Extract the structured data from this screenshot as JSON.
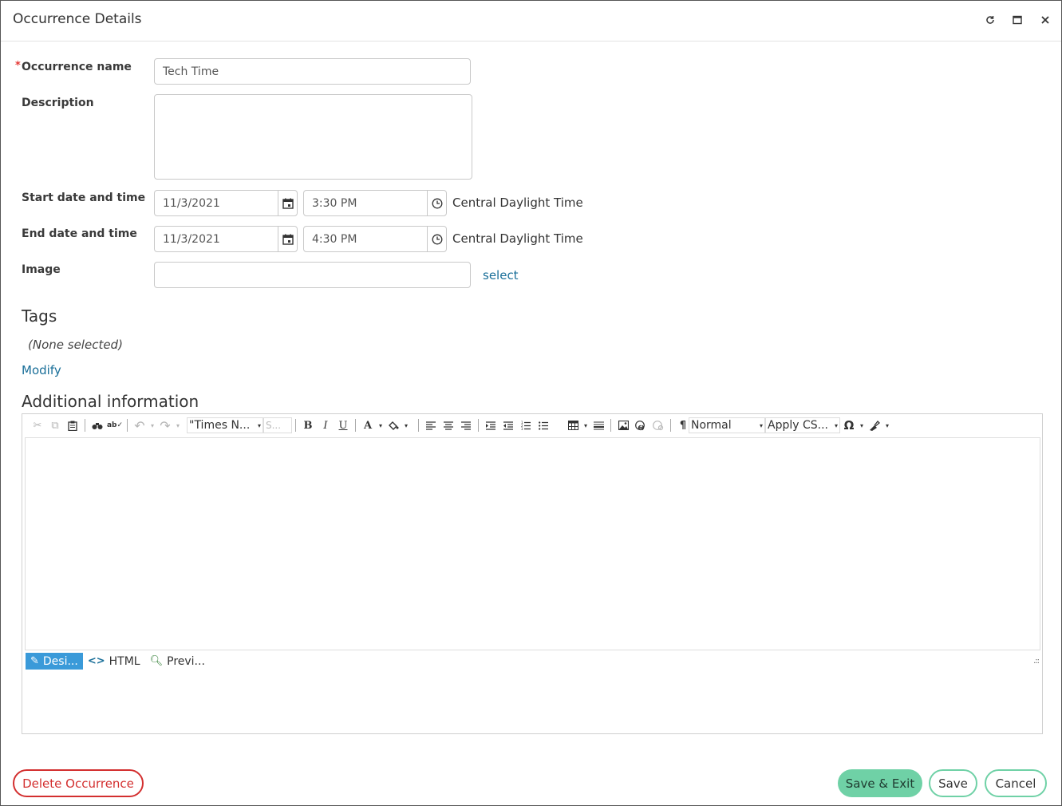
{
  "window": {
    "title": "Occurrence Details",
    "refresh_icon": "refresh-icon",
    "maximize_icon": "maximize-icon",
    "close_icon": "close-icon"
  },
  "form": {
    "occurrence_name": {
      "label": "Occurrence name",
      "required_mark": "*",
      "value": "Tech Time"
    },
    "description": {
      "label": "Description",
      "value": ""
    },
    "start": {
      "label": "Start date and time",
      "date": "11/3/2021",
      "time": "3:30 PM",
      "timezone": "Central Daylight Time"
    },
    "end": {
      "label": "End date and time",
      "date": "11/3/2021",
      "time": "4:30 PM",
      "timezone": "Central Daylight Time"
    },
    "image": {
      "label": "Image",
      "value": "",
      "select_link": "select"
    }
  },
  "tags": {
    "heading": "Tags",
    "none_selected": "(None selected)",
    "modify_link": "Modify"
  },
  "additional": {
    "heading": "Additional information",
    "toolbar": {
      "font_name": "\"Times N...",
      "font_size": "S...",
      "paragraph_style": "Normal",
      "css_class": "Apply CS...",
      "bold": "B",
      "italic": "I",
      "underline": "U",
      "font_color": "A",
      "omega": "Ω",
      "pilcrow": "¶"
    },
    "modes": {
      "design": "Desi...",
      "html": "HTML",
      "preview": "Previ..."
    }
  },
  "footer": {
    "delete_label": "Delete Occurrence",
    "save_exit_label": "Save & Exit",
    "save_label": "Save",
    "cancel_label": "Cancel"
  },
  "colors": {
    "accent_link": "#1a6f99",
    "delete_red": "#d32f2f",
    "save_exit_green": "#6fd1a6",
    "outline_green": "#6fd1a6",
    "required_red": "#e53935",
    "active_mode_blue": "#3a9ad9"
  }
}
